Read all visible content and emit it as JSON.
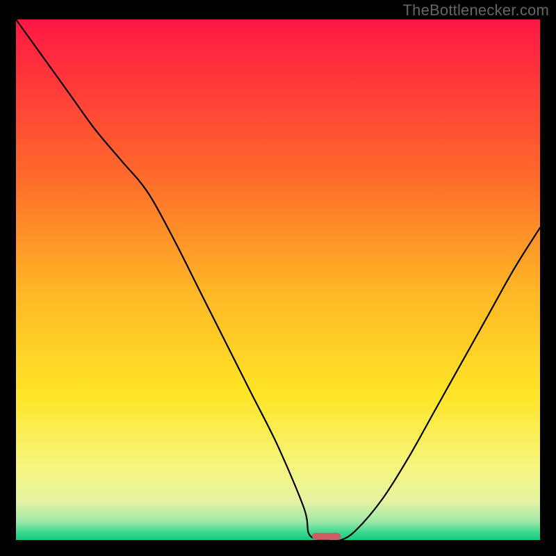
{
  "watermark": "TheBottlenecker.com",
  "chart_data": {
    "type": "line",
    "title": "",
    "xlabel": "",
    "ylabel": "",
    "xlim": [
      0,
      100
    ],
    "ylim": [
      0,
      100
    ],
    "grid": false,
    "x": [
      0,
      5,
      10,
      15,
      20,
      25,
      30,
      35,
      40,
      45,
      50,
      55,
      56,
      59,
      62,
      65,
      70,
      75,
      80,
      85,
      90,
      95,
      100
    ],
    "values": [
      100,
      93,
      86,
      79,
      73,
      67,
      58,
      48,
      38,
      28,
      18,
      6,
      1,
      0,
      0,
      2,
      8,
      16,
      25,
      34,
      43,
      52,
      60
    ],
    "background": {
      "type": "vertical-gradient",
      "stops": [
        {
          "pos": 0.0,
          "color": "#ff1744"
        },
        {
          "pos": 0.3,
          "color": "#ff6a2b"
        },
        {
          "pos": 0.52,
          "color": "#ffb626"
        },
        {
          "pos": 0.72,
          "color": "#ffe527"
        },
        {
          "pos": 0.86,
          "color": "#f6f57e"
        },
        {
          "pos": 0.925,
          "color": "#e6f3a3"
        },
        {
          "pos": 0.965,
          "color": "#9de8a8"
        },
        {
          "pos": 0.985,
          "color": "#3dd88f"
        },
        {
          "pos": 1.0,
          "color": "#14c97f"
        }
      ]
    },
    "marker": {
      "x_range": [
        56.5,
        62
      ],
      "y": 0.7,
      "color": "#cb5d63"
    }
  }
}
